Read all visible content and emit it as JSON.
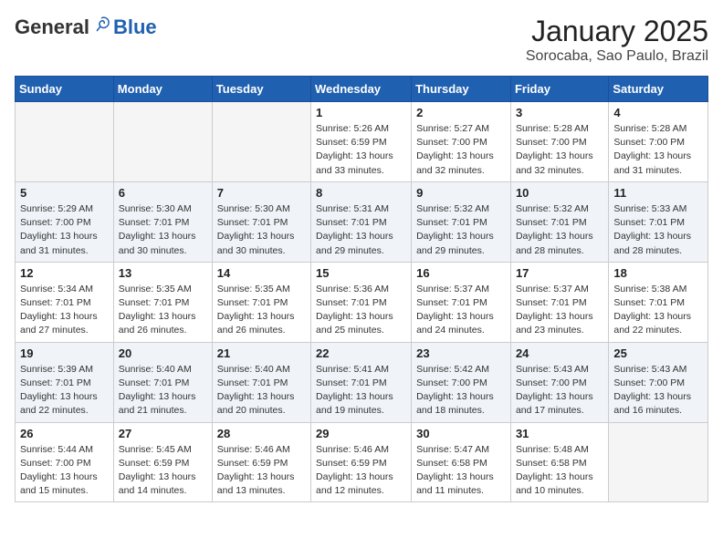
{
  "header": {
    "logo_general": "General",
    "logo_blue": "Blue",
    "month_title": "January 2025",
    "location": "Sorocaba, Sao Paulo, Brazil"
  },
  "weekdays": [
    "Sunday",
    "Monday",
    "Tuesday",
    "Wednesday",
    "Thursday",
    "Friday",
    "Saturday"
  ],
  "weeks": [
    [
      {
        "day": "",
        "detail": ""
      },
      {
        "day": "",
        "detail": ""
      },
      {
        "day": "",
        "detail": ""
      },
      {
        "day": "1",
        "detail": "Sunrise: 5:26 AM\nSunset: 6:59 PM\nDaylight: 13 hours\nand 33 minutes."
      },
      {
        "day": "2",
        "detail": "Sunrise: 5:27 AM\nSunset: 7:00 PM\nDaylight: 13 hours\nand 32 minutes."
      },
      {
        "day": "3",
        "detail": "Sunrise: 5:28 AM\nSunset: 7:00 PM\nDaylight: 13 hours\nand 32 minutes."
      },
      {
        "day": "4",
        "detail": "Sunrise: 5:28 AM\nSunset: 7:00 PM\nDaylight: 13 hours\nand 31 minutes."
      }
    ],
    [
      {
        "day": "5",
        "detail": "Sunrise: 5:29 AM\nSunset: 7:00 PM\nDaylight: 13 hours\nand 31 minutes."
      },
      {
        "day": "6",
        "detail": "Sunrise: 5:30 AM\nSunset: 7:01 PM\nDaylight: 13 hours\nand 30 minutes."
      },
      {
        "day": "7",
        "detail": "Sunrise: 5:30 AM\nSunset: 7:01 PM\nDaylight: 13 hours\nand 30 minutes."
      },
      {
        "day": "8",
        "detail": "Sunrise: 5:31 AM\nSunset: 7:01 PM\nDaylight: 13 hours\nand 29 minutes."
      },
      {
        "day": "9",
        "detail": "Sunrise: 5:32 AM\nSunset: 7:01 PM\nDaylight: 13 hours\nand 29 minutes."
      },
      {
        "day": "10",
        "detail": "Sunrise: 5:32 AM\nSunset: 7:01 PM\nDaylight: 13 hours\nand 28 minutes."
      },
      {
        "day": "11",
        "detail": "Sunrise: 5:33 AM\nSunset: 7:01 PM\nDaylight: 13 hours\nand 28 minutes."
      }
    ],
    [
      {
        "day": "12",
        "detail": "Sunrise: 5:34 AM\nSunset: 7:01 PM\nDaylight: 13 hours\nand 27 minutes."
      },
      {
        "day": "13",
        "detail": "Sunrise: 5:35 AM\nSunset: 7:01 PM\nDaylight: 13 hours\nand 26 minutes."
      },
      {
        "day": "14",
        "detail": "Sunrise: 5:35 AM\nSunset: 7:01 PM\nDaylight: 13 hours\nand 26 minutes."
      },
      {
        "day": "15",
        "detail": "Sunrise: 5:36 AM\nSunset: 7:01 PM\nDaylight: 13 hours\nand 25 minutes."
      },
      {
        "day": "16",
        "detail": "Sunrise: 5:37 AM\nSunset: 7:01 PM\nDaylight: 13 hours\nand 24 minutes."
      },
      {
        "day": "17",
        "detail": "Sunrise: 5:37 AM\nSunset: 7:01 PM\nDaylight: 13 hours\nand 23 minutes."
      },
      {
        "day": "18",
        "detail": "Sunrise: 5:38 AM\nSunset: 7:01 PM\nDaylight: 13 hours\nand 22 minutes."
      }
    ],
    [
      {
        "day": "19",
        "detail": "Sunrise: 5:39 AM\nSunset: 7:01 PM\nDaylight: 13 hours\nand 22 minutes."
      },
      {
        "day": "20",
        "detail": "Sunrise: 5:40 AM\nSunset: 7:01 PM\nDaylight: 13 hours\nand 21 minutes."
      },
      {
        "day": "21",
        "detail": "Sunrise: 5:40 AM\nSunset: 7:01 PM\nDaylight: 13 hours\nand 20 minutes."
      },
      {
        "day": "22",
        "detail": "Sunrise: 5:41 AM\nSunset: 7:01 PM\nDaylight: 13 hours\nand 19 minutes."
      },
      {
        "day": "23",
        "detail": "Sunrise: 5:42 AM\nSunset: 7:00 PM\nDaylight: 13 hours\nand 18 minutes."
      },
      {
        "day": "24",
        "detail": "Sunrise: 5:43 AM\nSunset: 7:00 PM\nDaylight: 13 hours\nand 17 minutes."
      },
      {
        "day": "25",
        "detail": "Sunrise: 5:43 AM\nSunset: 7:00 PM\nDaylight: 13 hours\nand 16 minutes."
      }
    ],
    [
      {
        "day": "26",
        "detail": "Sunrise: 5:44 AM\nSunset: 7:00 PM\nDaylight: 13 hours\nand 15 minutes."
      },
      {
        "day": "27",
        "detail": "Sunrise: 5:45 AM\nSunset: 6:59 PM\nDaylight: 13 hours\nand 14 minutes."
      },
      {
        "day": "28",
        "detail": "Sunrise: 5:46 AM\nSunset: 6:59 PM\nDaylight: 13 hours\nand 13 minutes."
      },
      {
        "day": "29",
        "detail": "Sunrise: 5:46 AM\nSunset: 6:59 PM\nDaylight: 13 hours\nand 12 minutes."
      },
      {
        "day": "30",
        "detail": "Sunrise: 5:47 AM\nSunset: 6:58 PM\nDaylight: 13 hours\nand 11 minutes."
      },
      {
        "day": "31",
        "detail": "Sunrise: 5:48 AM\nSunset: 6:58 PM\nDaylight: 13 hours\nand 10 minutes."
      },
      {
        "day": "",
        "detail": ""
      }
    ]
  ]
}
